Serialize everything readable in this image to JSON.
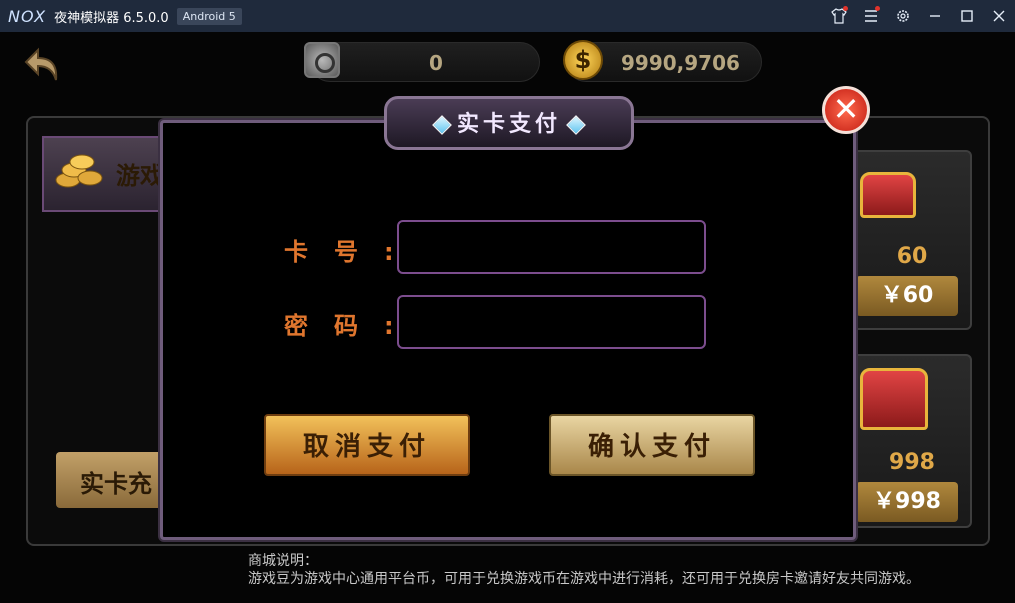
{
  "titlebar": {
    "logo": "NOX",
    "title": "夜神模拟器 6.5.0.0",
    "android_badge": "Android 5",
    "icons": [
      "shirt-icon",
      "menu-icon",
      "gear-icon",
      "minimize-icon",
      "maximize-icon",
      "close-icon"
    ]
  },
  "header": {
    "diamonds": "0",
    "coins": "9990,9706",
    "coin_symbol": "$"
  },
  "shop": {
    "tab_label": "游戏",
    "card_button_label": "实卡充",
    "items": [
      {
        "beans": "60",
        "price": "￥60"
      },
      {
        "beans": "998",
        "price": "￥998"
      }
    ],
    "description_title": "商城说明：",
    "description_body": "游戏豆为游戏中心通用平台币，可用于兑换游戏币在游戏中进行消耗，还可用于兑换房卡邀请好友共同游戏。"
  },
  "modal": {
    "title": "实卡支付",
    "card_label": "卡号:",
    "card_value": "",
    "password_label": "密码:",
    "password_value": "",
    "cancel_label": "取消支付",
    "confirm_label": "确认支付",
    "close_symbol": "✕"
  },
  "colors": {
    "titlebar_bg": "#1f2a3c",
    "label_orange": "#e0762e",
    "input_border": "#7c4d8e",
    "modal_border": "#6f5c7c"
  }
}
